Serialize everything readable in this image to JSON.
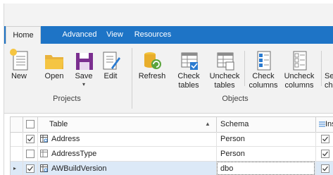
{
  "tabs": [
    "Home",
    "Advanced",
    "View",
    "Resources"
  ],
  "ribbon": {
    "buttons": {
      "new": "New",
      "open": "Open",
      "save": "Save",
      "edit": "Edit",
      "refresh": "Refresh",
      "check_tables_1": "Check",
      "check_tables_2": "tables",
      "uncheck_tables_1": "Uncheck",
      "uncheck_tables_2": "tables",
      "check_columns_1": "Check",
      "check_columns_2": "columns",
      "uncheck_columns_1": "Uncheck",
      "uncheck_columns_2": "columns",
      "cut_1": "Se",
      "cut_2": "ch"
    },
    "groups": {
      "projects": "Projects",
      "objects": "Objects"
    }
  },
  "grid": {
    "headers": {
      "table": "Table",
      "schema": "Schema",
      "insert": "Inse"
    },
    "rows": [
      {
        "table": "Address",
        "schema": "Person",
        "checked": true
      },
      {
        "table": "AddressType",
        "schema": "Person",
        "checked": false
      },
      {
        "table": "AWBuildVersion",
        "schema": "dbo",
        "checked": true
      }
    ]
  }
}
